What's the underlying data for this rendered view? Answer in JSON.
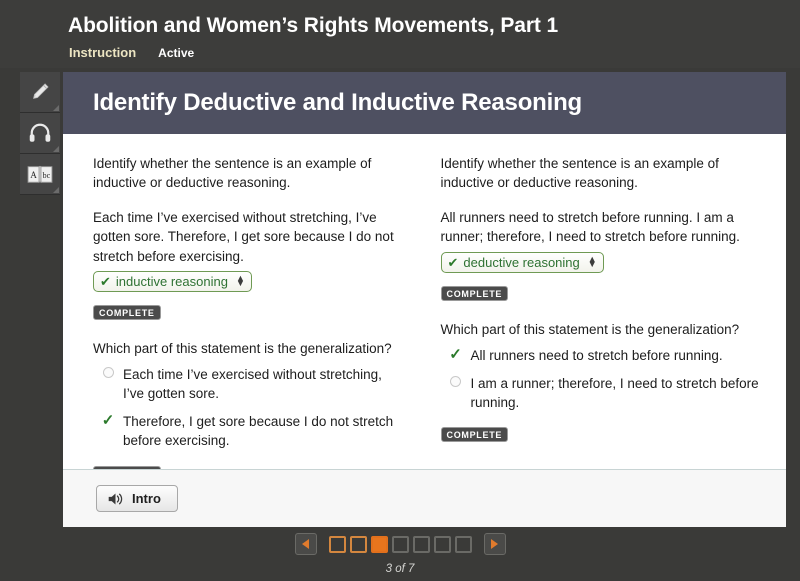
{
  "header": {
    "title": "Abolition and Women’s Rights Movements, Part 1",
    "instruction_label": "Instruction",
    "status_label": "Active"
  },
  "tools": [
    {
      "name": "highlighter-tool",
      "icon": "pencil-icon"
    },
    {
      "name": "audio-tool",
      "icon": "headphones-icon"
    },
    {
      "name": "dictionary-tool",
      "icon": "dictionary-book-icon"
    }
  ],
  "stage": {
    "title": "Identify Deductive and Inductive Reasoning",
    "columns": [
      {
        "prompt": "Identify whether the sentence is an example of inductive or deductive reasoning.",
        "stem": "Each time I’ve exercised without stretching, I’ve gotten sore. Therefore, I get sore because I do not stretch before exercising.",
        "select_value": "inductive reasoning",
        "select_check": "✔",
        "complete_label": "COMPLETE",
        "question": "Which part of this statement is the generalization?",
        "choices": [
          {
            "text": "Each time I’ve exercised without stretching, I’ve gotten sore.",
            "selected": false
          },
          {
            "text": "Therefore, I get sore because I do not stretch before exercising.",
            "selected": true
          }
        ],
        "complete_label_2": "COMPLETE"
      },
      {
        "prompt": "Identify whether the sentence is an example of inductive or deductive reasoning.",
        "stem": "All runners need to stretch before running. I am a runner; therefore, I need to stretch before running.",
        "select_value": "deductive reasoning",
        "select_check": "✔",
        "complete_label": "COMPLETE",
        "question": "Which part of this statement is the generalization?",
        "choices": [
          {
            "text": "All runners need to stretch before running.",
            "selected": true
          },
          {
            "text": "I am a runner; therefore, I need to stretch before running.",
            "selected": false
          }
        ],
        "complete_label_2": "COMPLETE"
      }
    ],
    "footer": {
      "intro_button_label": "Intro",
      "intro_button_icon": "speaker-icon"
    }
  },
  "pager": {
    "prev_icon": "arrow-left-icon",
    "next_icon": "arrow-right-icon",
    "total_pages": 7,
    "current_page": 3,
    "visited_pages": 2,
    "page_count_label": "3 of 7",
    "accent_color": "#e8751d",
    "visited_color": "#d4873f",
    "inactive_color": "#6a6a66"
  }
}
